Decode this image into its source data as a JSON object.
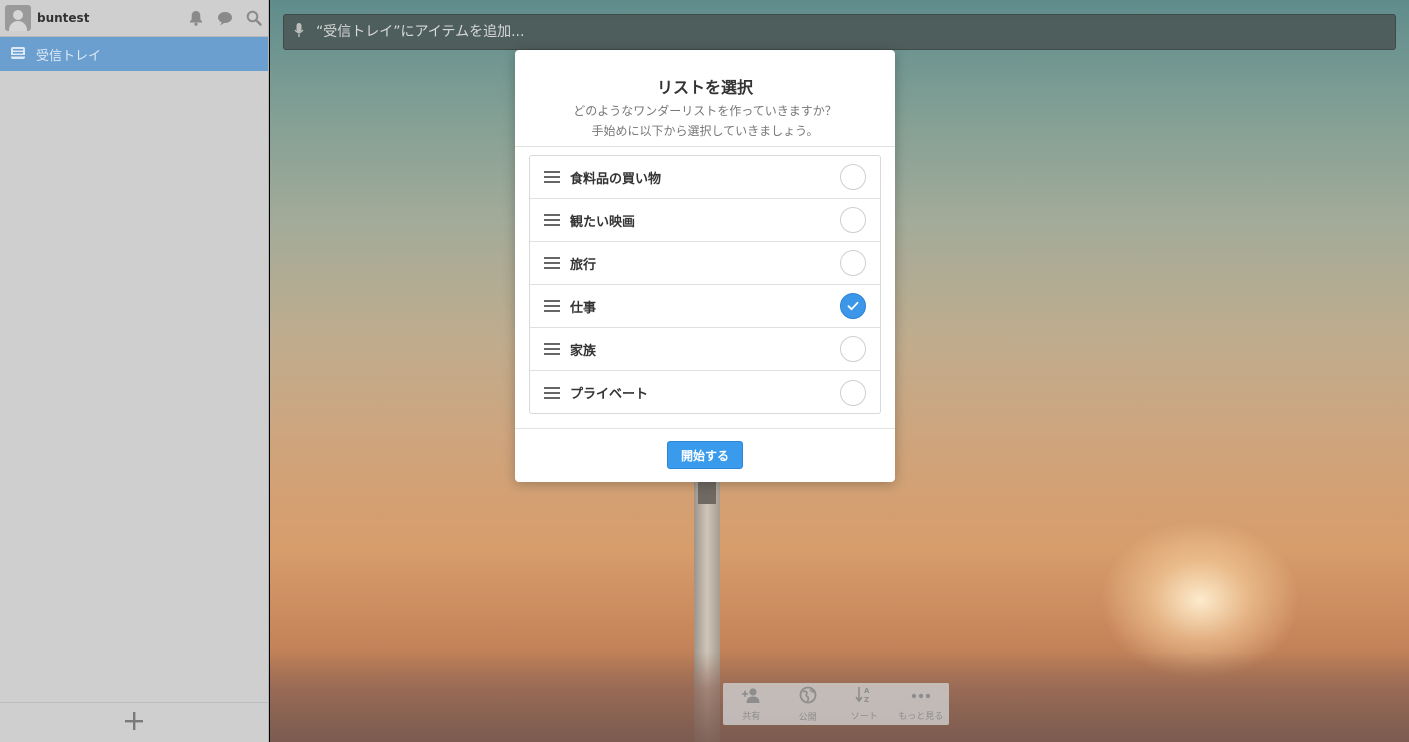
{
  "sidebar": {
    "username": "buntest",
    "icons": [
      "bell-icon",
      "chat-bubble-icon",
      "search-icon"
    ],
    "inbox_label": "受信トレイ",
    "add_list_icon": "plus-icon"
  },
  "main": {
    "add_item_placeholder": "“受信トレイ”にアイテムを追加...",
    "toolbar": [
      {
        "label": "共有",
        "icon": "add-person-icon"
      },
      {
        "label": "公開",
        "icon": "globe-icon"
      },
      {
        "label": "ソート",
        "icon": "sort-az-icon"
      },
      {
        "label": "もっと見る",
        "icon": "more-dots-icon"
      }
    ]
  },
  "modal": {
    "title": "リストを選択",
    "subtitle_line1": "どのようなワンダーリストを作っていきますか？",
    "subtitle_line2": "手始めに以下から選択していきましょう。",
    "items": [
      {
        "label": "食料品の買い物",
        "checked": false
      },
      {
        "label": "観たい映画",
        "checked": false
      },
      {
        "label": "旅行",
        "checked": false
      },
      {
        "label": "仕事",
        "checked": true
      },
      {
        "label": "家族",
        "checked": false
      },
      {
        "label": "プライベート",
        "checked": false
      }
    ],
    "start_button": "開始する"
  },
  "colors": {
    "accent": "#3a9bec",
    "sidebar_selected": "#6a9fd0",
    "sidebar_bg": "#cfcfcf"
  }
}
